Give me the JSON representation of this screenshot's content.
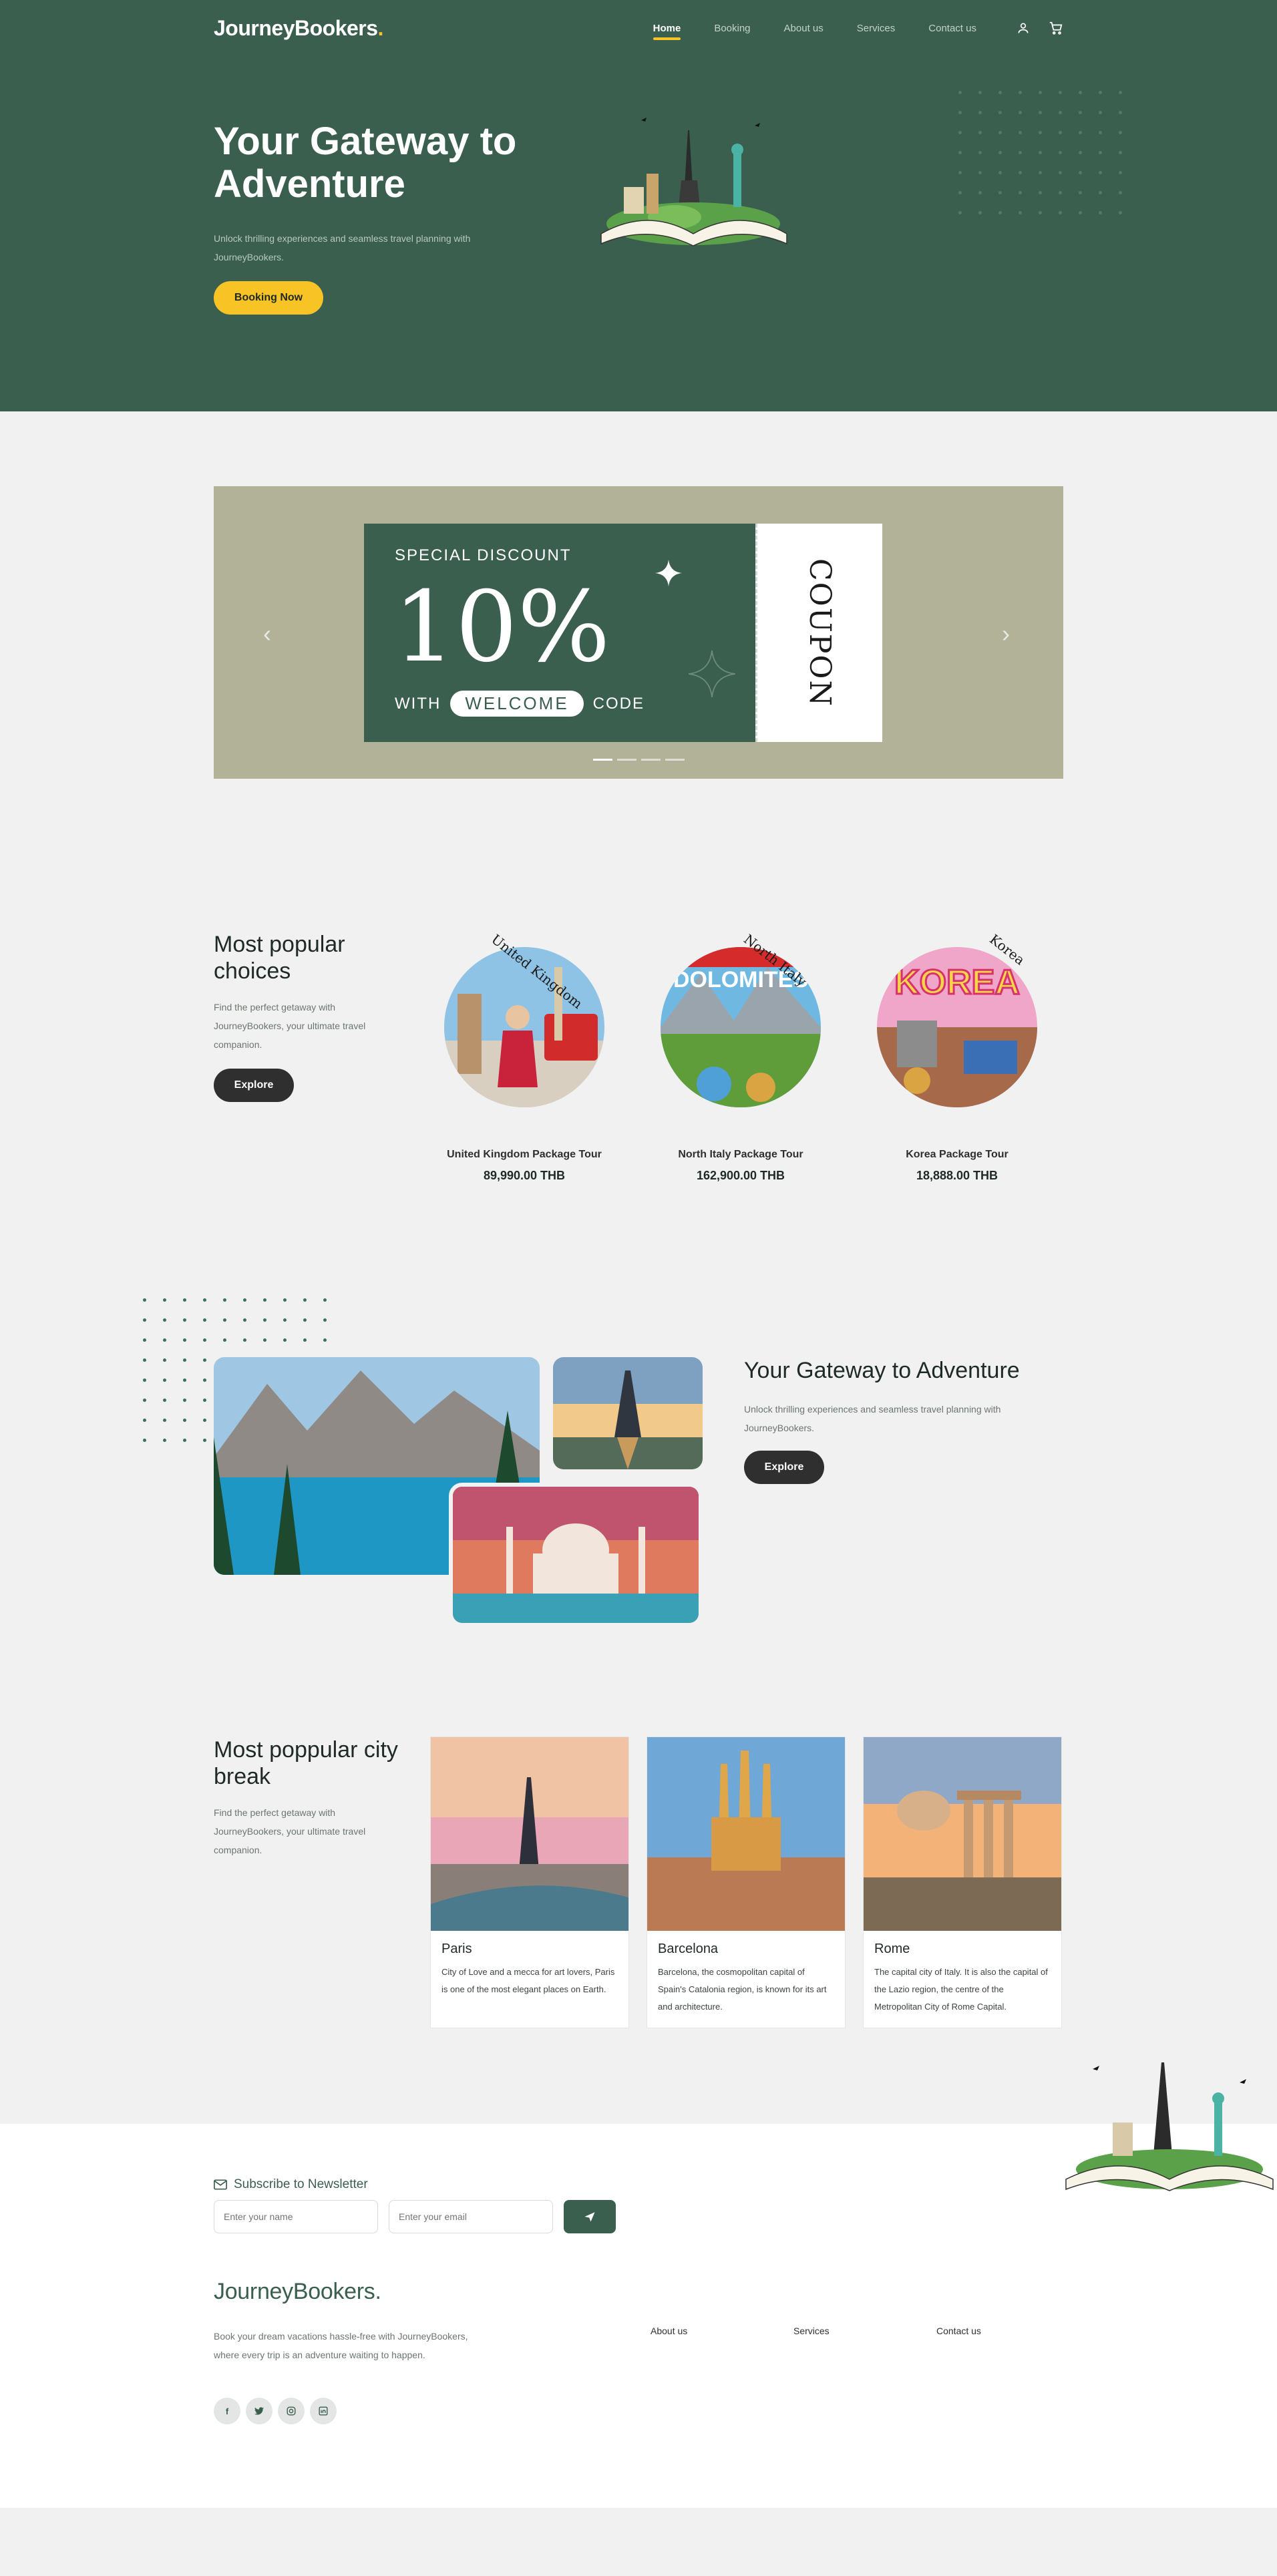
{
  "brand": {
    "name": "JourneyBookers",
    "dot": ".",
    "accent": "#f7c325",
    "primary": "#3b5f4f"
  },
  "nav": {
    "links": [
      "Home",
      "Booking",
      "About us",
      "Services",
      "Contact us"
    ],
    "active": "Home",
    "icons": [
      "user-icon",
      "cart-icon"
    ]
  },
  "hero": {
    "title": "Your Gateway to Adventure",
    "subtitle": "Unlock thrilling experiences and seamless travel planning with JourneyBookers.",
    "cta": "Booking Now"
  },
  "promo": {
    "heading": "SPECIAL DISCOUNT",
    "percent": "10%",
    "with": "WITH",
    "code": "WELCOME",
    "code_suffix": "CODE",
    "stub": "COUPON",
    "slides": 4,
    "active_slide": 1
  },
  "popular": {
    "title": "Most popular choices",
    "subtitle": "Find the perfect getaway with JourneyBookers, your ultimate travel companion.",
    "cta": "Explore",
    "tours": [
      {
        "label": "United Kingdom",
        "name": "United Kingdom Package Tour",
        "price": "89,990.00 THB"
      },
      {
        "label": "North Italy",
        "badge": "DOLOMITES",
        "name": "North Italy Package Tour",
        "price": "162,900.00 THB"
      },
      {
        "label": "Korea",
        "badge": "KOREA",
        "name": "Korea Package Tour",
        "price": "18,888.00 THB"
      }
    ]
  },
  "gateway": {
    "title": "Your Gateway to Adventure",
    "subtitle": "Unlock thrilling experiences and seamless travel planning with JourneyBookers.",
    "cta": "Explore"
  },
  "city": {
    "title": "Most poppular city break",
    "subtitle": "Find the perfect getaway with JourneyBookers, your ultimate travel companion.",
    "cards": [
      {
        "name": "Paris",
        "desc": "City of Love and a mecca for art lovers, Paris is one of the most elegant places on Earth."
      },
      {
        "name": "Barcelona",
        "desc": "Barcelona, the cosmopolitan capital of Spain's Catalonia region, is known for its art and architecture."
      },
      {
        "name": "Rome",
        "desc": "The capital city of Italy. It is also the capital of the Lazio region, the centre of the Metropolitan City of Rome Capital."
      }
    ]
  },
  "footer": {
    "newsletter_title": "Subscribe to Newsletter",
    "name_placeholder": "Enter your name",
    "email_placeholder": "Enter your email",
    "logo": "JourneyBookers.",
    "desc": "Book your dream vacations hassle-free with JourneyBookers, where every trip is an adventure waiting to happen.",
    "links": [
      "About us",
      "Services",
      "Contact us"
    ],
    "socials": [
      "facebook-icon",
      "twitter-icon",
      "instagram-icon",
      "linkedin-icon"
    ]
  }
}
